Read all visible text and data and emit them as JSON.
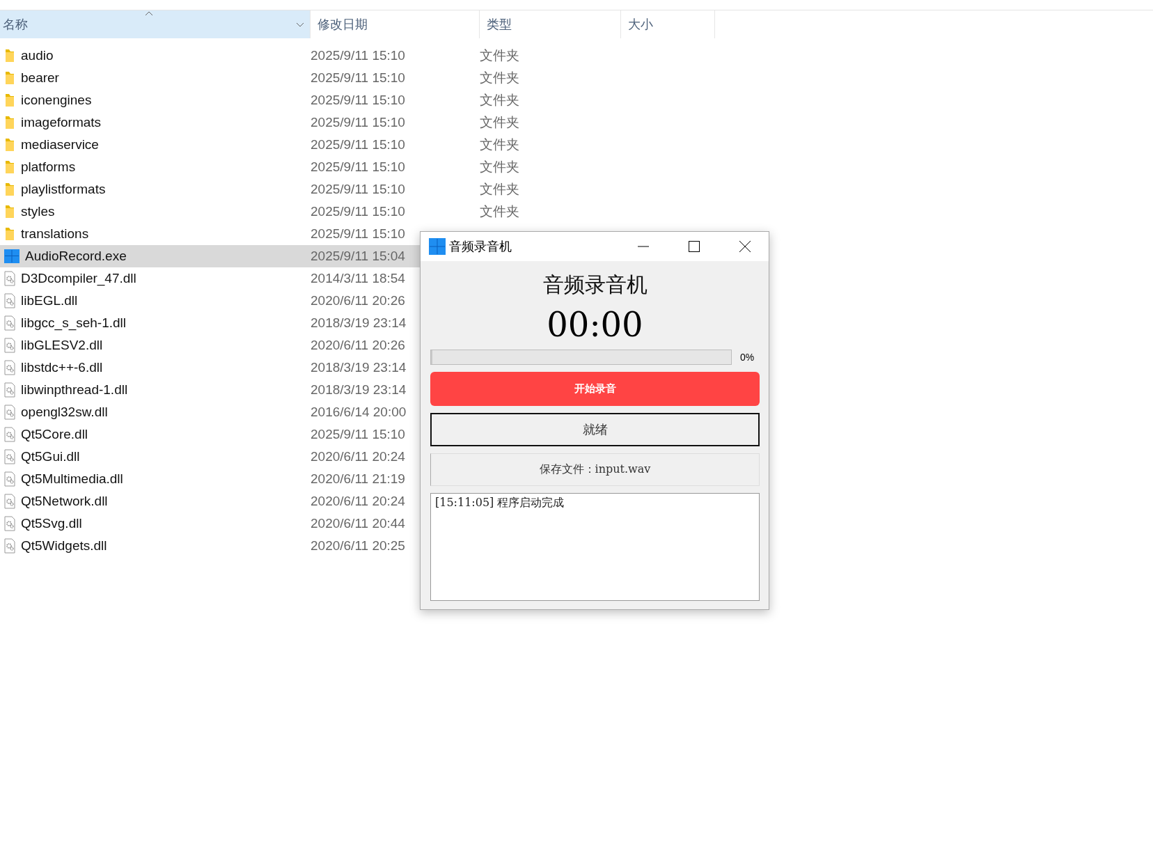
{
  "explorer": {
    "columns": [
      {
        "label": "名称",
        "sorted": true
      },
      {
        "label": "修改日期",
        "sorted": false
      },
      {
        "label": "类型",
        "sorted": false
      },
      {
        "label": "大小",
        "sorted": false
      }
    ],
    "files": [
      {
        "name": "audio",
        "date": "2025/9/11 15:10",
        "type": "文件夹",
        "kind": "folder",
        "selected": false
      },
      {
        "name": "bearer",
        "date": "2025/9/11 15:10",
        "type": "文件夹",
        "kind": "folder",
        "selected": false
      },
      {
        "name": "iconengines",
        "date": "2025/9/11 15:10",
        "type": "文件夹",
        "kind": "folder",
        "selected": false
      },
      {
        "name": "imageformats",
        "date": "2025/9/11 15:10",
        "type": "文件夹",
        "kind": "folder",
        "selected": false
      },
      {
        "name": "mediaservice",
        "date": "2025/9/11 15:10",
        "type": "文件夹",
        "kind": "folder",
        "selected": false
      },
      {
        "name": "platforms",
        "date": "2025/9/11 15:10",
        "type": "文件夹",
        "kind": "folder",
        "selected": false
      },
      {
        "name": "playlistformats",
        "date": "2025/9/11 15:10",
        "type": "文件夹",
        "kind": "folder",
        "selected": false
      },
      {
        "name": "styles",
        "date": "2025/9/11 15:10",
        "type": "文件夹",
        "kind": "folder",
        "selected": false
      },
      {
        "name": "translations",
        "date": "2025/9/11 15:10",
        "kind": "folder",
        "selected": false
      },
      {
        "name": "AudioRecord.exe",
        "date": "2025/9/11 15:04",
        "kind": "exe",
        "selected": true
      },
      {
        "name": "D3Dcompiler_47.dll",
        "date": "2014/3/11 18:54",
        "kind": "dll",
        "selected": false
      },
      {
        "name": "libEGL.dll",
        "date": "2020/6/11 20:26",
        "kind": "dll",
        "selected": false
      },
      {
        "name": "libgcc_s_seh-1.dll",
        "date": "2018/3/19 23:14",
        "kind": "dll",
        "selected": false
      },
      {
        "name": "libGLESV2.dll",
        "date": "2020/6/11 20:26",
        "kind": "dll",
        "selected": false
      },
      {
        "name": "libstdc++-6.dll",
        "date": "2018/3/19 23:14",
        "kind": "dll",
        "selected": false
      },
      {
        "name": "libwinpthread-1.dll",
        "date": "2018/3/19 23:14",
        "kind": "dll",
        "selected": false
      },
      {
        "name": "opengl32sw.dll",
        "date": "2016/6/14 20:00",
        "kind": "dll",
        "selected": false
      },
      {
        "name": "Qt5Core.dll",
        "date": "2025/9/11 15:10",
        "kind": "dll",
        "selected": false
      },
      {
        "name": "Qt5Gui.dll",
        "date": "2020/6/11 20:24",
        "kind": "dll",
        "selected": false
      },
      {
        "name": "Qt5Multimedia.dll",
        "date": "2020/6/11 21:19",
        "kind": "dll",
        "selected": false
      },
      {
        "name": "Qt5Network.dll",
        "date": "2020/6/11 20:24",
        "kind": "dll",
        "selected": false
      },
      {
        "name": "Qt5Svg.dll",
        "date": "2020/6/11 20:44",
        "kind": "dll",
        "selected": false
      },
      {
        "name": "Qt5Widgets.dll",
        "date": "2020/6/11 20:25",
        "kind": "dll",
        "selected": false
      }
    ]
  },
  "dialog": {
    "title": "音频录音机",
    "heading": "音频录音机",
    "timer": "00:00",
    "progress": {
      "level": 0,
      "reading": "0%"
    },
    "record_button": "开始录音",
    "status": "就绪",
    "save_file": "保存文件：input.wav",
    "log": [
      "[15:11:05] 程序启动完成"
    ]
  }
}
